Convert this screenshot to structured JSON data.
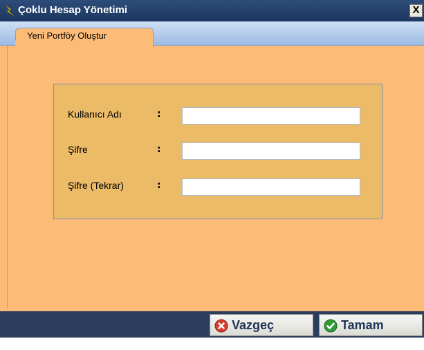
{
  "window": {
    "title": "Çoklu Hesap Yönetimi",
    "close_label": "X"
  },
  "tabs": [
    {
      "label": "Yeni Portföy Oluştur",
      "selected": true
    }
  ],
  "form": {
    "fields": [
      {
        "label": "Kullanıcı Adı",
        "separator": ":",
        "value": ""
      },
      {
        "label": "Şifre",
        "separator": ":",
        "value": ""
      },
      {
        "label": "Şifre (Tekrar)",
        "separator": ":",
        "value": ""
      }
    ]
  },
  "buttons": {
    "cancel": {
      "label": "Vazgeç",
      "icon": "cancel-x-icon",
      "color": "#d43c2c"
    },
    "ok": {
      "label": "Tamam",
      "icon": "check-icon",
      "color": "#2f9a37"
    }
  },
  "colors": {
    "background": "#fdbb78",
    "panel": "#ecbb67",
    "titlebar": "#1d3760",
    "bottom_bar": "#2b3d5c"
  }
}
